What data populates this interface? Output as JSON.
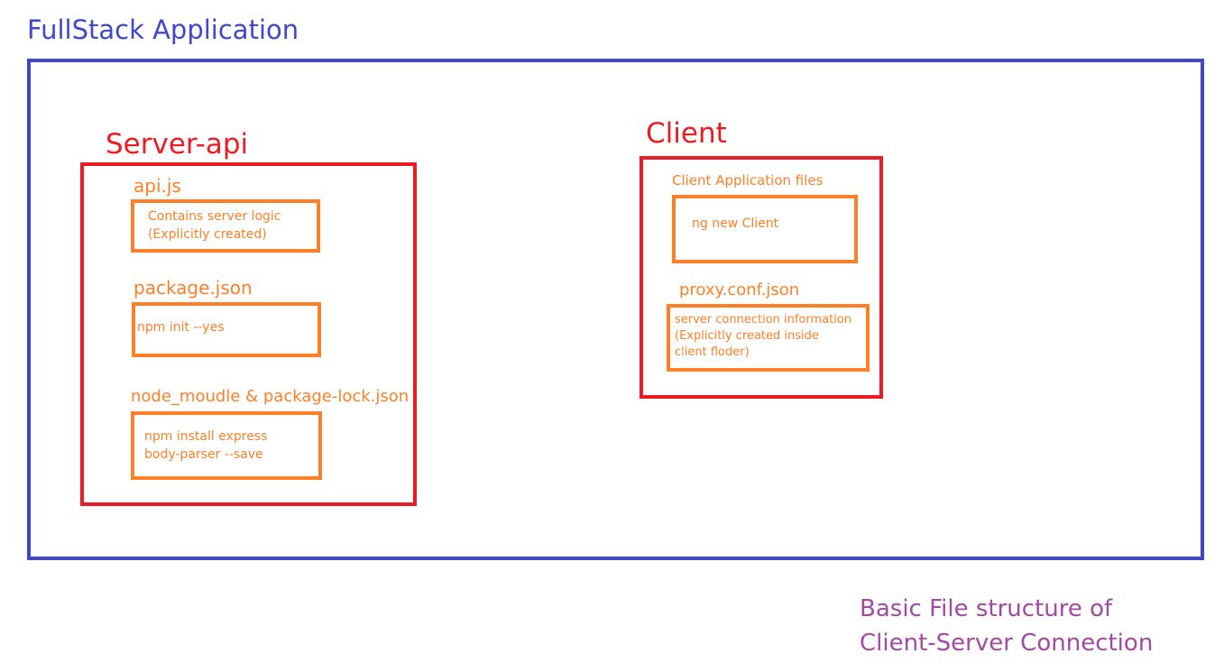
{
  "diagram": {
    "title": "FullStack Application",
    "server": {
      "title": "Server-api",
      "files": [
        {
          "name": "api.js",
          "lines": [
            "Contains server logic",
            "(Explicitly created)"
          ]
        },
        {
          "name": "package.json",
          "lines": [
            "npm init --yes"
          ]
        },
        {
          "name": "node_moudle & package-lock.json",
          "lines": [
            "npm install express",
            "body-parser --save"
          ]
        }
      ]
    },
    "client": {
      "title": "Client",
      "files": [
        {
          "name": "Client Application files",
          "lines": [
            "ng new Client"
          ]
        },
        {
          "name": "proxy.conf.json",
          "lines": [
            "server connection information",
            "(Explicitly created inside",
            "client floder)"
          ]
        }
      ]
    },
    "caption": {
      "line1": "Basic File structure of",
      "line2": "Client-Server Connection"
    },
    "colors": {
      "app": "#3f48cc",
      "section": "#ed1c24",
      "file": "#ff7f27",
      "caption": "#a349a4"
    }
  }
}
